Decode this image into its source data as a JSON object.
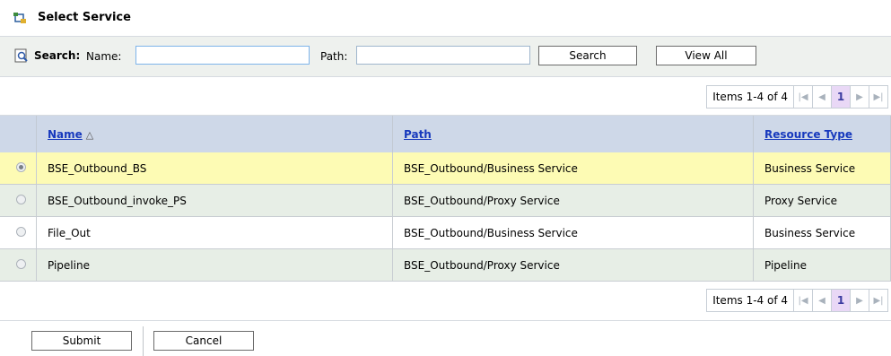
{
  "dialog": {
    "title": "Select Service",
    "title_icon": "service-tree-icon"
  },
  "search": {
    "label": "Search:",
    "name_label": "Name:",
    "name_value": "",
    "path_label": "Path:",
    "path_value": "",
    "search_button": "Search",
    "view_all_button": "View All"
  },
  "pager": {
    "items_text": "Items 1-4 of 4",
    "current_page": "1",
    "first_icon": "first-page-icon",
    "prev_icon": "prev-page-icon",
    "next_icon": "next-page-icon",
    "last_icon": "last-page-icon"
  },
  "table": {
    "columns": {
      "name": "Name",
      "path": "Path",
      "resource_type": "Resource Type"
    },
    "sort_indicator": "△",
    "rows": [
      {
        "name": "BSE_Outbound_BS",
        "path": "BSE_Outbound/Business Service",
        "resource_type": "Business Service",
        "selected": true
      },
      {
        "name": "BSE_Outbound_invoke_PS",
        "path": "BSE_Outbound/Proxy Service",
        "resource_type": "Proxy Service",
        "selected": false
      },
      {
        "name": "File_Out",
        "path": "BSE_Outbound/Business Service",
        "resource_type": "Business Service",
        "selected": false
      },
      {
        "name": "Pipeline",
        "path": "BSE_Outbound/Proxy Service",
        "resource_type": "Pipeline",
        "selected": false
      }
    ]
  },
  "actions": {
    "submit": "Submit",
    "cancel": "Cancel"
  },
  "colors": {
    "header_bg": "#ced8e8",
    "selected_row": "#fdfbb4",
    "alt_row": "#e7eee6",
    "link": "#1739bd"
  }
}
